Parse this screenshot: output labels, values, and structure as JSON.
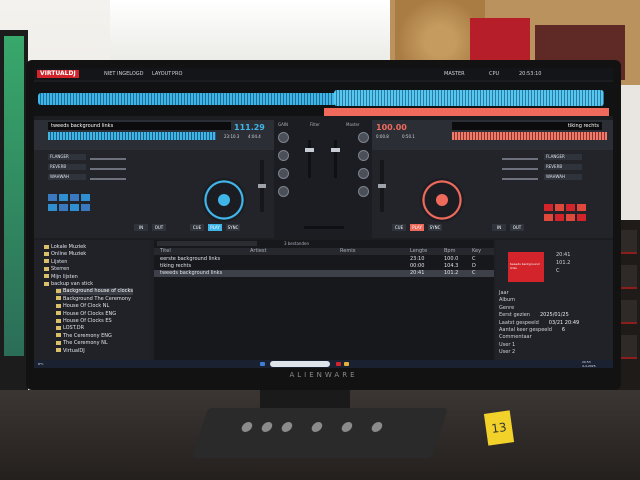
{
  "app": {
    "logo": "VIRTUALDJ",
    "user": "NIET INGELOGD",
    "layout_label": "LAYOUT",
    "layout_value": "PRO",
    "master_label": "MASTER",
    "cpu_label": "CPU",
    "clock": "20:53:10"
  },
  "deck_left": {
    "title": "tweeds background links",
    "bpm": "111.29",
    "time": "23:10.3",
    "remain": "4:04.4",
    "effects": [
      "FLANGER",
      "REVERB",
      "WAHWAH"
    ],
    "buttons": [
      "CUE",
      "PLAY",
      "SYNC",
      "IN",
      "OUT"
    ]
  },
  "deck_right": {
    "title": "tiking rechts",
    "bpm": "100.00",
    "time": "0:00.8",
    "remain": "0:50.1",
    "effects": [
      "FLANGER",
      "REVERB",
      "WAHWAH"
    ],
    "buttons": [
      "CUE",
      "PLAY",
      "SYNC",
      "IN",
      "OUT"
    ]
  },
  "mixer": {
    "labels": [
      "GAIN",
      "Filter",
      "HIGH",
      "MID",
      "LOW",
      "Master"
    ]
  },
  "browser": {
    "count": "3 bestanden",
    "folders": [
      {
        "label": "Lokale Muziek",
        "sub": false
      },
      {
        "label": "Online Muziek",
        "sub": false
      },
      {
        "label": "Lijsten",
        "sub": false
      },
      {
        "label": "Sterren",
        "sub": false
      },
      {
        "label": "Mijn lijsten",
        "sub": false
      },
      {
        "label": "backup van stick",
        "sub": false
      },
      {
        "label": "Background house of clocks",
        "sub": true
      },
      {
        "label": "Background The Ceremony",
        "sub": true
      },
      {
        "label": "House Of Clock NL",
        "sub": true
      },
      {
        "label": "House Of Clocks ENG",
        "sub": true
      },
      {
        "label": "House Of Clocks ES",
        "sub": true
      },
      {
        "label": "LOST.DR",
        "sub": true
      },
      {
        "label": "The Ceremony ENG",
        "sub": true
      },
      {
        "label": "The Ceremony NL",
        "sub": true
      },
      {
        "label": "VirtualDJ",
        "sub": true
      }
    ],
    "columns": [
      "Titel",
      "Artiest",
      "Remix",
      "Lengte",
      "Bpm",
      "Key"
    ],
    "tracks": [
      {
        "title": "eerste background links",
        "artist": "",
        "remix": "",
        "length": "23:10",
        "bpm": "100.0",
        "key": "C"
      },
      {
        "title": "tiking rechts",
        "artist": "",
        "remix": "",
        "length": "00:00",
        "bpm": "104.3",
        "key": "D"
      },
      {
        "title": "tweeds background links",
        "artist": "",
        "remix": "",
        "length": "20:41",
        "bpm": "101.2",
        "key": "C"
      }
    ]
  },
  "info": {
    "cover_title": "tweeds background links",
    "time": "20:41",
    "bpm": "101.2",
    "key": "C",
    "fields": [
      {
        "k": "Jaar",
        "v": ""
      },
      {
        "k": "Album",
        "v": ""
      },
      {
        "k": "Genre",
        "v": ""
      },
      {
        "k": "Eerst gezien",
        "v": "2025/01/25"
      },
      {
        "k": "Laatst gespeeld",
        "v": "03/21 20:49"
      },
      {
        "k": "Aantal keer gespeeld",
        "v": "6"
      },
      {
        "k": "Commentaar",
        "v": ""
      },
      {
        "k": "User 1",
        "v": ""
      },
      {
        "k": "User 2",
        "v": ""
      }
    ]
  },
  "taskbar": {
    "weather": "8°C",
    "time": "20:53",
    "date": "4-4-2025"
  },
  "monitor_brand": "ALIENWARE",
  "sticker": "13"
}
